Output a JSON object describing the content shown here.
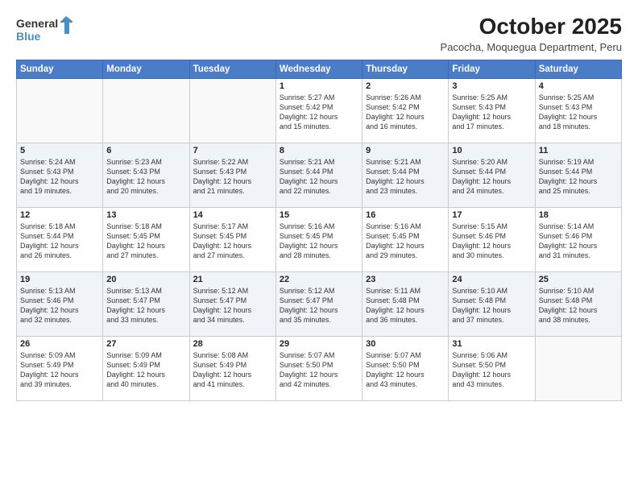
{
  "header": {
    "logo_line1": "General",
    "logo_line2": "Blue",
    "title": "October 2025",
    "subtitle": "Pacocha, Moquegua Department, Peru"
  },
  "weekdays": [
    "Sunday",
    "Monday",
    "Tuesday",
    "Wednesday",
    "Thursday",
    "Friday",
    "Saturday"
  ],
  "weeks": [
    [
      {
        "day": "",
        "info": ""
      },
      {
        "day": "",
        "info": ""
      },
      {
        "day": "",
        "info": ""
      },
      {
        "day": "1",
        "info": "Sunrise: 5:27 AM\nSunset: 5:42 PM\nDaylight: 12 hours\nand 15 minutes."
      },
      {
        "day": "2",
        "info": "Sunrise: 5:26 AM\nSunset: 5:42 PM\nDaylight: 12 hours\nand 16 minutes."
      },
      {
        "day": "3",
        "info": "Sunrise: 5:25 AM\nSunset: 5:43 PM\nDaylight: 12 hours\nand 17 minutes."
      },
      {
        "day": "4",
        "info": "Sunrise: 5:25 AM\nSunset: 5:43 PM\nDaylight: 12 hours\nand 18 minutes."
      }
    ],
    [
      {
        "day": "5",
        "info": "Sunrise: 5:24 AM\nSunset: 5:43 PM\nDaylight: 12 hours\nand 19 minutes."
      },
      {
        "day": "6",
        "info": "Sunrise: 5:23 AM\nSunset: 5:43 PM\nDaylight: 12 hours\nand 20 minutes."
      },
      {
        "day": "7",
        "info": "Sunrise: 5:22 AM\nSunset: 5:43 PM\nDaylight: 12 hours\nand 21 minutes."
      },
      {
        "day": "8",
        "info": "Sunrise: 5:21 AM\nSunset: 5:44 PM\nDaylight: 12 hours\nand 22 minutes."
      },
      {
        "day": "9",
        "info": "Sunrise: 5:21 AM\nSunset: 5:44 PM\nDaylight: 12 hours\nand 23 minutes."
      },
      {
        "day": "10",
        "info": "Sunrise: 5:20 AM\nSunset: 5:44 PM\nDaylight: 12 hours\nand 24 minutes."
      },
      {
        "day": "11",
        "info": "Sunrise: 5:19 AM\nSunset: 5:44 PM\nDaylight: 12 hours\nand 25 minutes."
      }
    ],
    [
      {
        "day": "12",
        "info": "Sunrise: 5:18 AM\nSunset: 5:44 PM\nDaylight: 12 hours\nand 26 minutes."
      },
      {
        "day": "13",
        "info": "Sunrise: 5:18 AM\nSunset: 5:45 PM\nDaylight: 12 hours\nand 27 minutes."
      },
      {
        "day": "14",
        "info": "Sunrise: 5:17 AM\nSunset: 5:45 PM\nDaylight: 12 hours\nand 27 minutes."
      },
      {
        "day": "15",
        "info": "Sunrise: 5:16 AM\nSunset: 5:45 PM\nDaylight: 12 hours\nand 28 minutes."
      },
      {
        "day": "16",
        "info": "Sunrise: 5:16 AM\nSunset: 5:45 PM\nDaylight: 12 hours\nand 29 minutes."
      },
      {
        "day": "17",
        "info": "Sunrise: 5:15 AM\nSunset: 5:46 PM\nDaylight: 12 hours\nand 30 minutes."
      },
      {
        "day": "18",
        "info": "Sunrise: 5:14 AM\nSunset: 5:46 PM\nDaylight: 12 hours\nand 31 minutes."
      }
    ],
    [
      {
        "day": "19",
        "info": "Sunrise: 5:13 AM\nSunset: 5:46 PM\nDaylight: 12 hours\nand 32 minutes."
      },
      {
        "day": "20",
        "info": "Sunrise: 5:13 AM\nSunset: 5:47 PM\nDaylight: 12 hours\nand 33 minutes."
      },
      {
        "day": "21",
        "info": "Sunrise: 5:12 AM\nSunset: 5:47 PM\nDaylight: 12 hours\nand 34 minutes."
      },
      {
        "day": "22",
        "info": "Sunrise: 5:12 AM\nSunset: 5:47 PM\nDaylight: 12 hours\nand 35 minutes."
      },
      {
        "day": "23",
        "info": "Sunrise: 5:11 AM\nSunset: 5:48 PM\nDaylight: 12 hours\nand 36 minutes."
      },
      {
        "day": "24",
        "info": "Sunrise: 5:10 AM\nSunset: 5:48 PM\nDaylight: 12 hours\nand 37 minutes."
      },
      {
        "day": "25",
        "info": "Sunrise: 5:10 AM\nSunset: 5:48 PM\nDaylight: 12 hours\nand 38 minutes."
      }
    ],
    [
      {
        "day": "26",
        "info": "Sunrise: 5:09 AM\nSunset: 5:49 PM\nDaylight: 12 hours\nand 39 minutes."
      },
      {
        "day": "27",
        "info": "Sunrise: 5:09 AM\nSunset: 5:49 PM\nDaylight: 12 hours\nand 40 minutes."
      },
      {
        "day": "28",
        "info": "Sunrise: 5:08 AM\nSunset: 5:49 PM\nDaylight: 12 hours\nand 41 minutes."
      },
      {
        "day": "29",
        "info": "Sunrise: 5:07 AM\nSunset: 5:50 PM\nDaylight: 12 hours\nand 42 minutes."
      },
      {
        "day": "30",
        "info": "Sunrise: 5:07 AM\nSunset: 5:50 PM\nDaylight: 12 hours\nand 43 minutes."
      },
      {
        "day": "31",
        "info": "Sunrise: 5:06 AM\nSunset: 5:50 PM\nDaylight: 12 hours\nand 43 minutes."
      },
      {
        "day": "",
        "info": ""
      }
    ]
  ]
}
